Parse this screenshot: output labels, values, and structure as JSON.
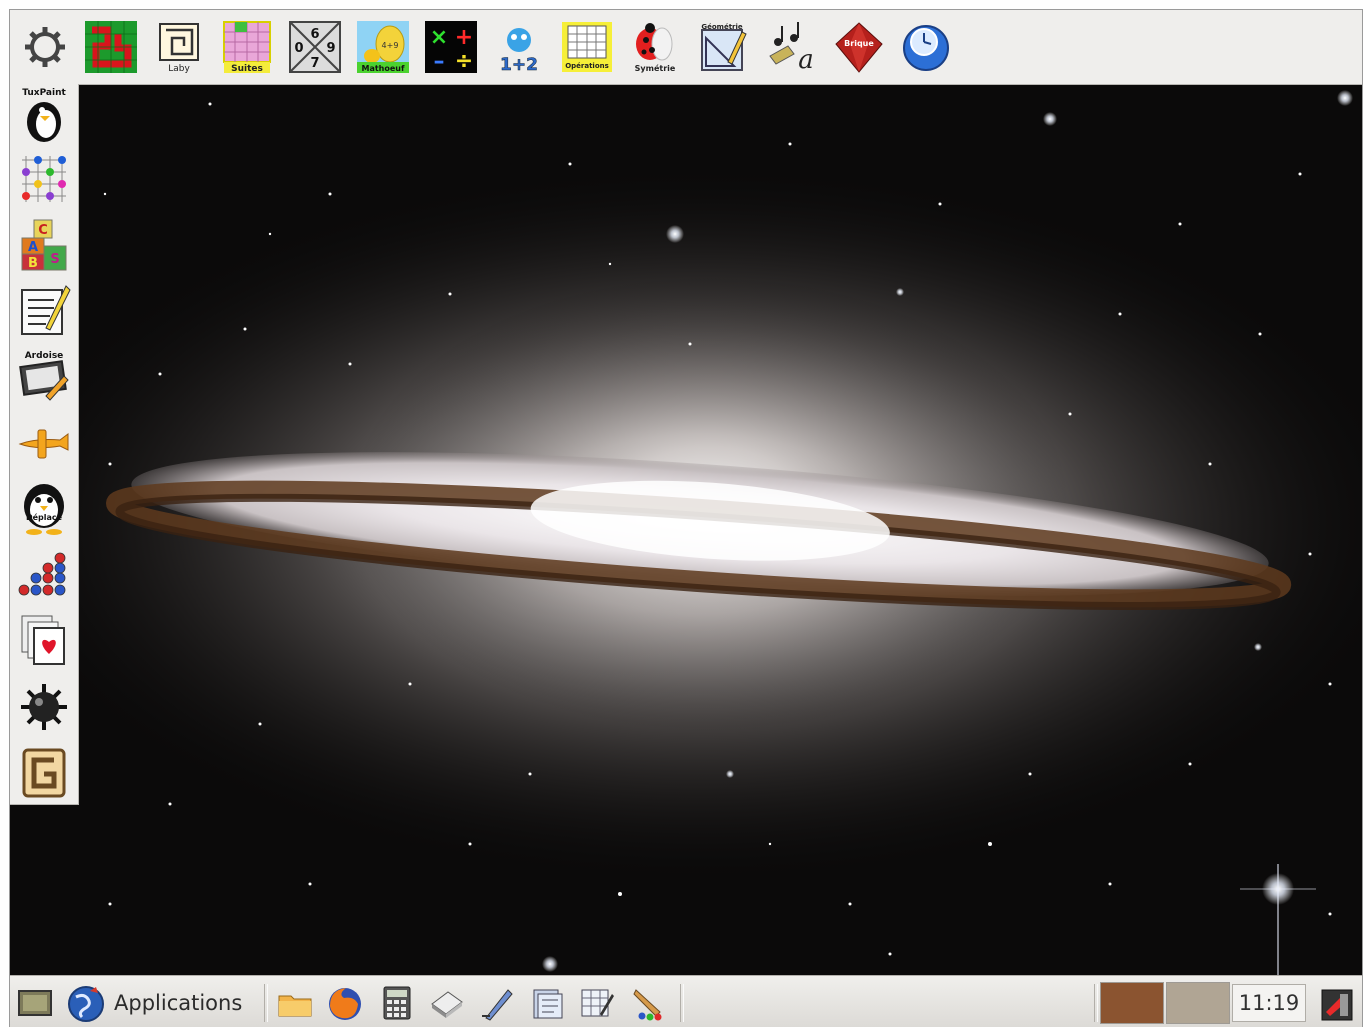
{
  "top_launcher": {
    "items": [
      {
        "icon": "settings-gear-icon"
      },
      {
        "icon": "puzzle-path-icon"
      },
      {
        "icon": "maze-icon",
        "label": "Laby"
      },
      {
        "icon": "grid-suites-icon",
        "label": "Suites"
      },
      {
        "icon": "number-puzzle-icon",
        "digits": [
          "6",
          "0",
          "9",
          "7"
        ]
      },
      {
        "icon": "mathoeuf-icon",
        "label": "Mathoeuf",
        "sub": "4+9"
      },
      {
        "icon": "calculate-icon"
      },
      {
        "icon": "counting-icon",
        "label": "1+2"
      },
      {
        "icon": "operations-icon",
        "label": "Opérations"
      },
      {
        "icon": "ladybug-icon",
        "label": "Symétrie"
      },
      {
        "icon": "geometry-icon",
        "label": "Géométrie"
      },
      {
        "icon": "music-icon",
        "label": "a"
      },
      {
        "icon": "crystal-icon",
        "label": "Brique"
      },
      {
        "icon": "clock-globe-icon"
      }
    ]
  },
  "left_launcher": {
    "items": [
      {
        "icon": "tuxpaint-icon",
        "label": "TuxPaint"
      },
      {
        "icon": "color-grid-icon"
      },
      {
        "icon": "letter-blocks-icon",
        "letters": [
          "C",
          "A",
          "B",
          "S"
        ]
      },
      {
        "icon": "text-editor-icon"
      },
      {
        "icon": "ardoise-icon",
        "label": "Ardoise"
      },
      {
        "icon": "airplane-icon"
      },
      {
        "icon": "penguin-icon",
        "label": "Déplace"
      },
      {
        "icon": "balls-icon"
      },
      {
        "icon": "cards-icon"
      },
      {
        "icon": "mine-icon"
      },
      {
        "icon": "gcompris-icon"
      }
    ]
  },
  "bottom_panel": {
    "applications_label": "Applications",
    "clock": "11:19",
    "workspace_colors": [
      "#8b5430",
      "#b0a594"
    ]
  },
  "colors": {
    "panel_bg": "#efeeec",
    "wallpaper": "#0c0b0b"
  }
}
